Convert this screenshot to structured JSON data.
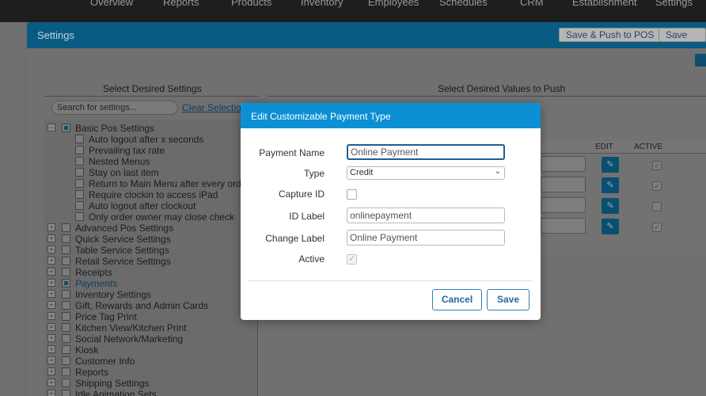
{
  "topnav": {
    "items": [
      "Overview",
      "Reports",
      "Products",
      "Inventory",
      "Employees",
      "Schedules",
      "CRM",
      "Establishment",
      "Settings"
    ]
  },
  "settings_bar": {
    "title": "Settings",
    "save_push_label": "Save & Push to POS",
    "save_label": "Save"
  },
  "left_column": {
    "heading": "Select Desired Settings",
    "search_placeholder": "Search for settings...",
    "clear_label": "Clear Selection",
    "tree": [
      {
        "label": "Basic Pos Settings",
        "toggle": "−",
        "state": "partial"
      },
      {
        "label": "Auto logout after x seconds",
        "child": true
      },
      {
        "label": "Prevailing tax rate",
        "child": true
      },
      {
        "label": "Nested Menus",
        "child": true
      },
      {
        "label": "Stay on last item",
        "child": true
      },
      {
        "label": "Return to Main Menu after every order",
        "child": true
      },
      {
        "label": "Require clockin to access iPad",
        "child": true
      },
      {
        "label": "Auto logout after clockout",
        "child": true
      },
      {
        "label": "Only order owner may close check",
        "child": true
      },
      {
        "label": "Advanced Pos Settings",
        "toggle": "+"
      },
      {
        "label": "Quick Service Settings",
        "toggle": "+"
      },
      {
        "label": "Table Service Settings",
        "toggle": "+"
      },
      {
        "label": "Retail Service Settings",
        "toggle": "+"
      },
      {
        "label": "Receipts",
        "toggle": "+"
      },
      {
        "label": "Payments",
        "toggle": "+",
        "state": "partial",
        "active": true
      },
      {
        "label": "Inventory Settings",
        "toggle": "+"
      },
      {
        "label": "Gift, Rewards and Admin Cards",
        "toggle": "+"
      },
      {
        "label": "Price Tag Print",
        "toggle": "+"
      },
      {
        "label": "Kitchen View/Kitchen Print",
        "toggle": "+"
      },
      {
        "label": "Social Network/Marketing",
        "toggle": "+"
      },
      {
        "label": "Kiosk",
        "toggle": "+"
      },
      {
        "label": "Customer Info",
        "toggle": "+"
      },
      {
        "label": "Reports",
        "toggle": "+"
      },
      {
        "label": "Shipping Settings",
        "toggle": "+"
      },
      {
        "label": "Idle Animation Sets",
        "toggle": "+"
      }
    ]
  },
  "right_column": {
    "heading": "Select Desired Values to Push",
    "table_headers": {
      "edit": "EDIT",
      "active": "ACTIVE"
    },
    "rows_active": [
      true,
      true,
      false,
      true
    ]
  },
  "modal": {
    "title": "Edit Customizable Payment Type",
    "fields": {
      "payment_name": {
        "label": "Payment Name",
        "value": "Online Payment"
      },
      "type": {
        "label": "Type",
        "value": "Credit"
      },
      "capture_id": {
        "label": "Capture ID",
        "checked": false
      },
      "id_label": {
        "label": "ID Label",
        "value": "onlinepayment"
      },
      "change_label": {
        "label": "Change Label",
        "value": "Online Payment"
      },
      "active": {
        "label": "Active",
        "checked": true
      }
    },
    "cancel_label": "Cancel",
    "save_label": "Save"
  }
}
